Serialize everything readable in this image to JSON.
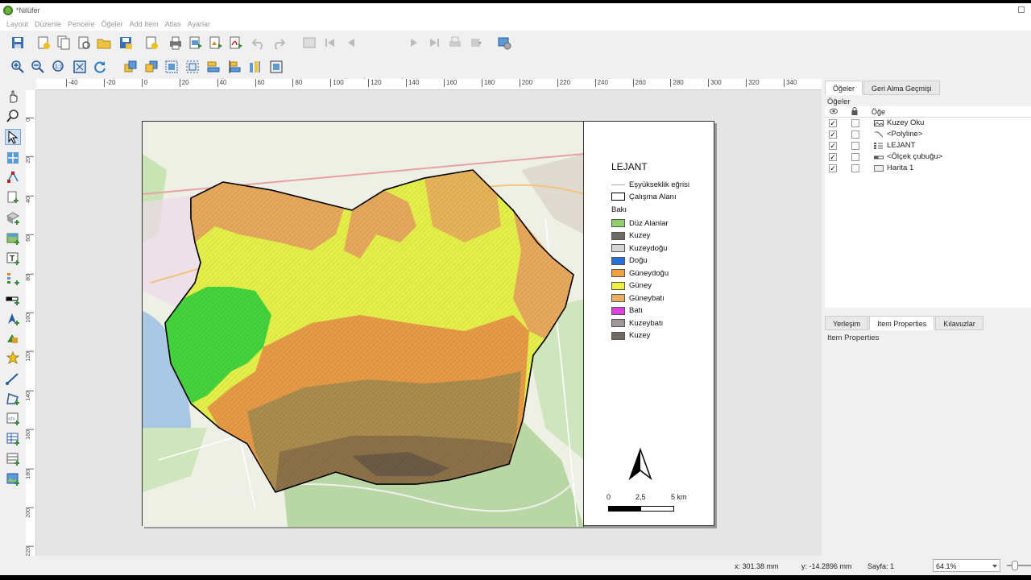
{
  "window": {
    "title": "*Nilüfer"
  },
  "menu": [
    "Layout",
    "Düzenle",
    "Pencere",
    "Öğeler",
    "Add Item",
    "Atlas",
    "Ayarlar"
  ],
  "toolbar": {
    "page_value": "1"
  },
  "ruler": {
    "h_ticks": [
      "-40",
      "-20",
      "0",
      "20",
      "40",
      "60",
      "80",
      "100",
      "120",
      "140",
      "160",
      "180",
      "200",
      "220",
      "240",
      "260",
      "280",
      "300",
      "320",
      "340"
    ],
    "v_ticks": [
      "0",
      "20",
      "40",
      "60",
      "80",
      "100",
      "120",
      "140",
      "160",
      "180",
      "200",
      "220"
    ]
  },
  "legend": {
    "title": "LEJANT",
    "items": [
      {
        "label": "Eşyükseklik eğrisi",
        "swatch": "line"
      },
      {
        "label": "Çalışma Alanı",
        "swatch": "box",
        "color": "#ffffff"
      }
    ],
    "group_label": "Bakı",
    "classes": [
      {
        "label": "Düz Alanlar",
        "color": "#8fd16a"
      },
      {
        "label": "Kuzey",
        "color": "#6e6a62"
      },
      {
        "label": "Kuzeydoğu",
        "color": "#d6d6d6"
      },
      {
        "label": "Doğu",
        "color": "#2a6fd6"
      },
      {
        "label": "Güneydoğu",
        "color": "#f0a040"
      },
      {
        "label": "Güney",
        "color": "#f0f040"
      },
      {
        "label": "Güneybatı",
        "color": "#e8b060"
      },
      {
        "label": "Batı",
        "color": "#e040e0"
      },
      {
        "label": "Kuzeybatı",
        "color": "#a09898"
      },
      {
        "label": "Kuzey",
        "color": "#6e6a62"
      }
    ]
  },
  "scalebar": {
    "labels": [
      "0",
      "2,5",
      "5 km"
    ]
  },
  "right_panel": {
    "top_tabs": [
      "Öğeler",
      "Geri Alma Geçmişi"
    ],
    "items_heading": "Öğeler",
    "table_header": "Öğe",
    "items": [
      {
        "name": "Kuzey Oku",
        "visible": true,
        "locked": false,
        "icon": "picture-icon"
      },
      {
        "name": "<Polyline>",
        "visible": true,
        "locked": false,
        "icon": "polyline-icon"
      },
      {
        "name": "LEJANT",
        "visible": true,
        "locked": false,
        "icon": "legend-icon"
      },
      {
        "name": "<Ölçek çubuğu>",
        "visible": true,
        "locked": false,
        "icon": "scalebar-icon"
      },
      {
        "name": "Harita 1",
        "visible": true,
        "locked": false,
        "icon": "map-icon"
      }
    ],
    "bottom_tabs": [
      "Yerleşim",
      "Item Properties",
      "Kılavuzlar"
    ],
    "properties_heading": "Item Properties"
  },
  "status": {
    "x": "x: 301.38 mm",
    "y": "y: -14.2896 mm",
    "page": "Sayfa: 1",
    "zoom": "64.1%"
  }
}
